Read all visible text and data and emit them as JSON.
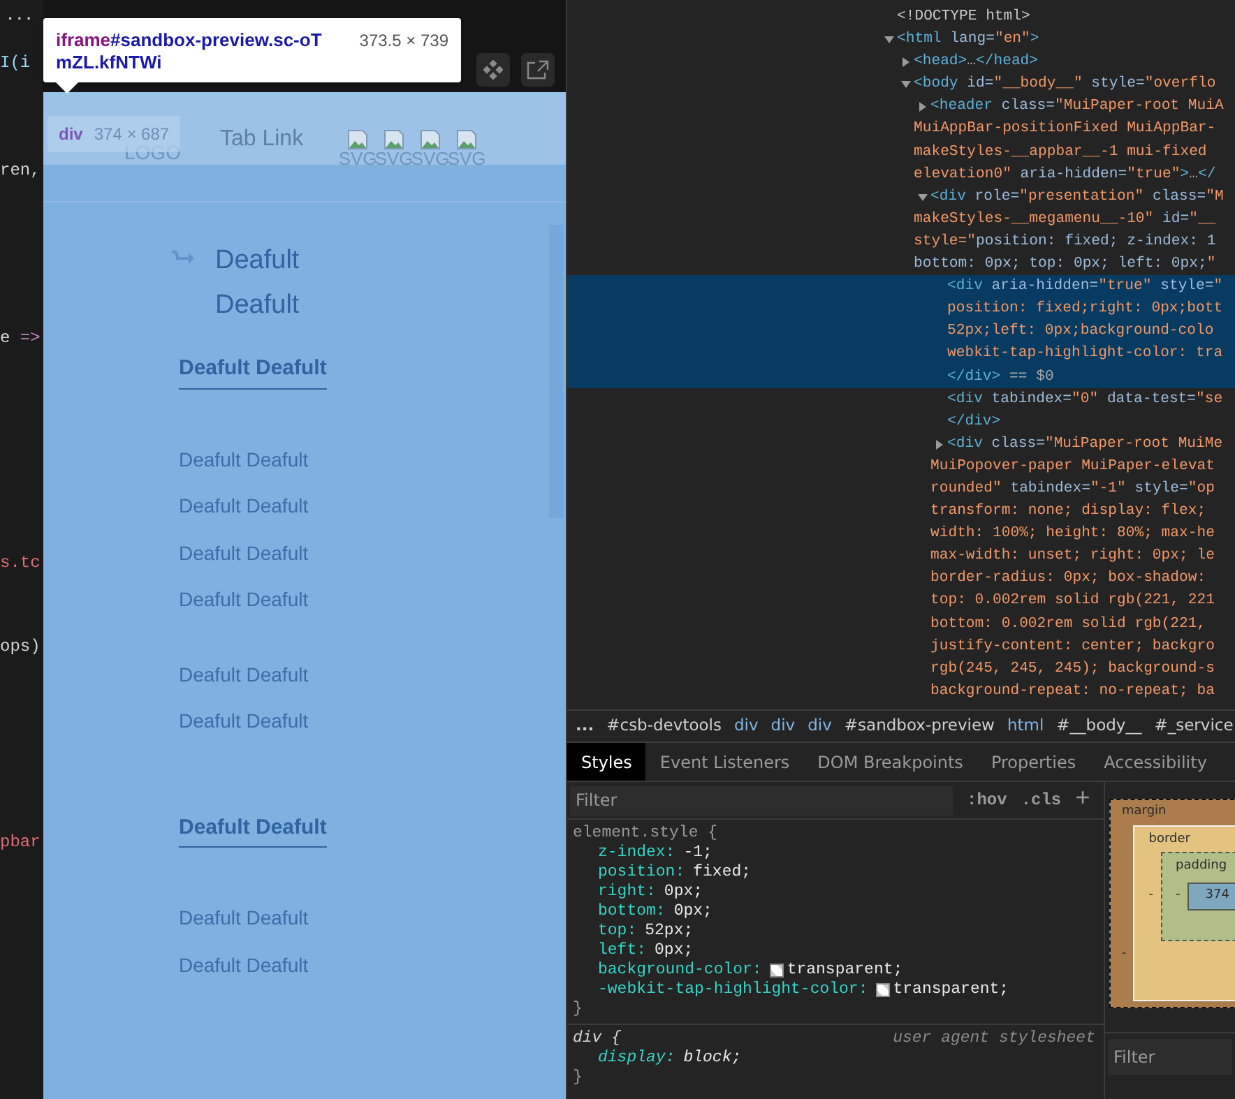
{
  "editor": {
    "more": "...",
    "fragments": [
      {
        "tokens": [
          {
            "text": "I(i",
            "color": "#9cdcfe"
          }
        ]
      },
      {
        "tokens": [
          {
            "text": "ren,",
            "color": "#d4d4d4"
          }
        ]
      },
      {
        "tokens": [
          {
            "text": "e ",
            "color": "#d4d4d4"
          },
          {
            "text": "=>",
            "color": "#c586c0"
          }
        ]
      },
      {
        "tokens": [
          {
            "text": "s.tc",
            "color": "#e06c75"
          }
        ]
      },
      {
        "tokens": [
          {
            "text": "ops)",
            "color": "#d4d4d4"
          }
        ]
      },
      {
        "tokens": [
          {
            "text": "pbar",
            "color": "#e06c75"
          }
        ]
      }
    ]
  },
  "inspect_tooltip": {
    "element": "iframe",
    "selector": "#sandbox-preview.sc-oTmZL.kfNTWi",
    "size": "373.5 × 739"
  },
  "hover_tooltip": {
    "element": "div",
    "size": "374 × 687"
  },
  "preview": {
    "logo": "LOGO",
    "tab_link": "Tab Link",
    "images": [
      {
        "alt": "SVG"
      },
      {
        "alt": "SVG"
      },
      {
        "alt": "SVG"
      },
      {
        "alt": "SVG"
      }
    ],
    "menu_title": "Deafult Deafult",
    "groups": [
      {
        "title": "Deafult Deafult",
        "links": [
          "Deafult Deafult",
          "Deafult Deafult",
          "Deafult Deafult",
          "Deafult Deafult"
        ]
      },
      {
        "links": [
          "Deafult Deafult",
          "Deafult Deafult"
        ]
      },
      {
        "title": "Deafult Deafult",
        "links": [
          "Deafult Deafult",
          "Deafult Deafult"
        ]
      }
    ]
  },
  "dom_tree": [
    {
      "kind": "doctype",
      "lines": [
        "<!DOCTYPE html>"
      ]
    },
    {
      "kind": "element",
      "expanded": true,
      "lines": [
        "<html lang=\"en\">"
      ],
      "children": [
        {
          "kind": "element",
          "expanded": false,
          "lines": [
            "<head>…</head>"
          ]
        },
        {
          "kind": "element",
          "expanded": true,
          "lines": [
            "<body id=\"__body__\" style=\"overflo"
          ],
          "children": [
            {
              "kind": "element",
              "expanded": false,
              "lines": [
                "<header class=\"MuiPaper-root MuiA",
                "MuiAppBar-positionFixed MuiAppBar-",
                "makeStyles-__appbar__-1 mui-fixed",
                "elevation0\" aria-hidden=\"true\">…</"
              ]
            },
            {
              "kind": "element",
              "expanded": true,
              "lines": [
                "<div role=\"presentation\" class=\"M",
                "makeStyles-__megamenu__-10\" id=\"__",
                "style=\"position: fixed; z-index: 1",
                "bottom: 0px; top: 0px; left: 0px;\""
              ],
              "children": [
                {
                  "kind": "element",
                  "selected": true,
                  "lines": [
                    "<div aria-hidden=\"true\" style=\"",
                    "position: fixed;right: 0px;bott",
                    "52px;left: 0px;background-colo",
                    "webkit-tap-highlight-color: tra",
                    "</div> == $0"
                  ]
                },
                {
                  "kind": "element",
                  "selected": false,
                  "lines": [
                    "<div tabindex=\"0\" data-test=\"se",
                    "</div>"
                  ]
                },
                {
                  "kind": "element",
                  "expanded": false,
                  "lines": [
                    "<div class=\"MuiPaper-root MuiMe",
                    "MuiPopover-paper MuiPaper-elevat",
                    "rounded\" tabindex=\"-1\" style=\"op",
                    "transform: none; display: flex;",
                    "width: 100%; height: 80%; max-he",
                    "max-width: unset; right: 0px; le",
                    "border-radius: 0px; box-shadow:",
                    "top: 0.002rem solid rgb(221, 221",
                    "bottom: 0.002rem solid rgb(221,",
                    "justify-content: center; backgro",
                    "rgb(245, 245, 245); background-s",
                    "background-repeat: no-repeat; ba"
                  ]
                }
              ]
            }
          ]
        }
      ]
    }
  ],
  "breadcrumb": [
    {
      "text": "...",
      "kind": "more"
    },
    {
      "text": "#csb-devtools",
      "kind": "id"
    },
    {
      "text": "div",
      "kind": "tag"
    },
    {
      "text": "div",
      "kind": "tag"
    },
    {
      "text": "div",
      "kind": "tag"
    },
    {
      "text": "#sandbox-preview",
      "kind": "id"
    },
    {
      "text": "html",
      "kind": "tag"
    },
    {
      "text": "#__body__",
      "kind": "id"
    },
    {
      "text": "#_service",
      "kind": "id"
    }
  ],
  "tabs": [
    {
      "label": "Styles",
      "selected": true
    },
    {
      "label": "Event Listeners",
      "selected": false
    },
    {
      "label": "DOM Breakpoints",
      "selected": false
    },
    {
      "label": "Properties",
      "selected": false
    },
    {
      "label": "Accessibility",
      "selected": false
    }
  ],
  "styles_filter": {
    "placeholder": "Filter",
    "buttons": [
      ":hov",
      ".cls",
      "+"
    ]
  },
  "rules": [
    {
      "selector": "element.style {",
      "kind": "inline",
      "close": "}",
      "properties": [
        {
          "name": "z-index:",
          "value": "-1;"
        },
        {
          "name": "position:",
          "value": "fixed;"
        },
        {
          "name": "right:",
          "value": "0px;"
        },
        {
          "name": "bottom:",
          "value": "0px;"
        },
        {
          "name": "top:",
          "value": "52px;"
        },
        {
          "name": "left:",
          "value": "0px;"
        },
        {
          "name": "background-color:",
          "value": "transparent;",
          "swatch": true
        },
        {
          "name": "-webkit-tap-highlight-color:",
          "value": "transparent;",
          "swatch": true
        }
      ]
    },
    {
      "selector": "div {",
      "kind": "user_agent",
      "source": "user agent stylesheet",
      "close": "}",
      "properties": [
        {
          "name": "display:",
          "value": "block;"
        }
      ]
    }
  ],
  "box_model": {
    "margin_label": "margin",
    "border_label": "border",
    "padding_label": "padding",
    "content": "374",
    "margin_left": "-",
    "border_left": "-",
    "padding_left": "-"
  },
  "computed_filter": {
    "placeholder": "Filter"
  }
}
